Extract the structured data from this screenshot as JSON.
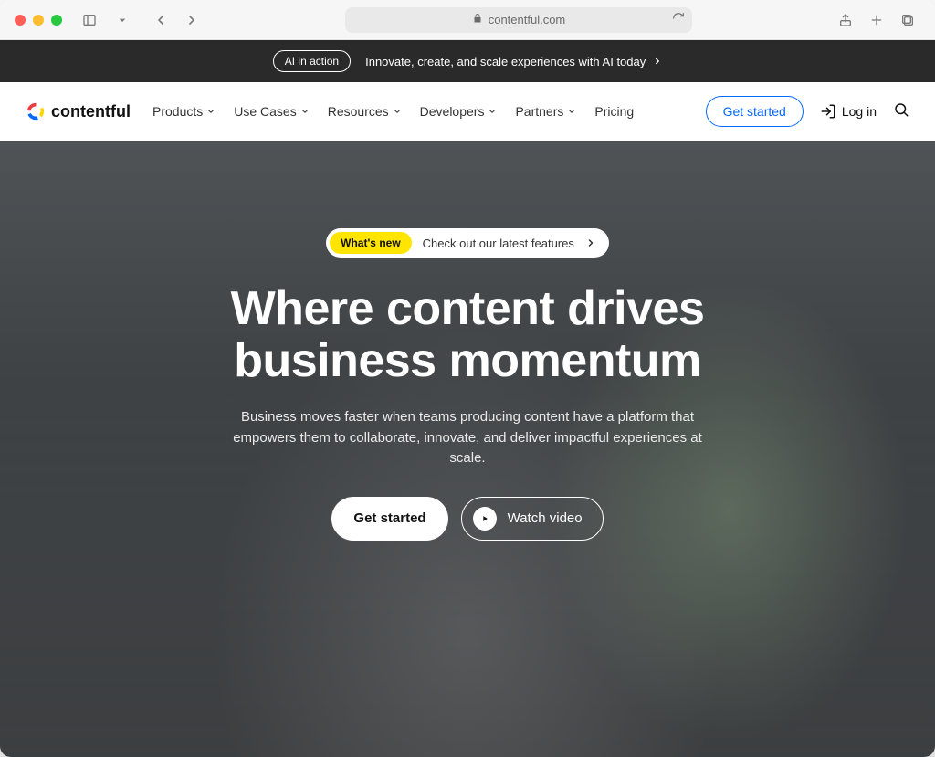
{
  "browser": {
    "url_host": "contentful.com"
  },
  "announcement": {
    "badge": "AI in action",
    "text": "Innovate, create, and scale experiences with AI today"
  },
  "brand": {
    "name": "contentful"
  },
  "nav": {
    "items": [
      {
        "label": "Products",
        "has_dropdown": true
      },
      {
        "label": "Use Cases",
        "has_dropdown": true
      },
      {
        "label": "Resources",
        "has_dropdown": true
      },
      {
        "label": "Developers",
        "has_dropdown": true
      },
      {
        "label": "Partners",
        "has_dropdown": true
      },
      {
        "label": "Pricing",
        "has_dropdown": false
      }
    ]
  },
  "header_actions": {
    "get_started": "Get started",
    "login": "Log in"
  },
  "hero": {
    "whatsnew_badge": "What's new",
    "whatsnew_text": "Check out our latest features",
    "headline_line1": "Where content drives",
    "headline_line2": "business momentum",
    "subcopy": "Business moves faster when teams producing content have a platform that empowers them to collaborate, innovate, and deliver impactful experiences at scale.",
    "cta_primary": "Get started",
    "cta_secondary": "Watch video"
  }
}
